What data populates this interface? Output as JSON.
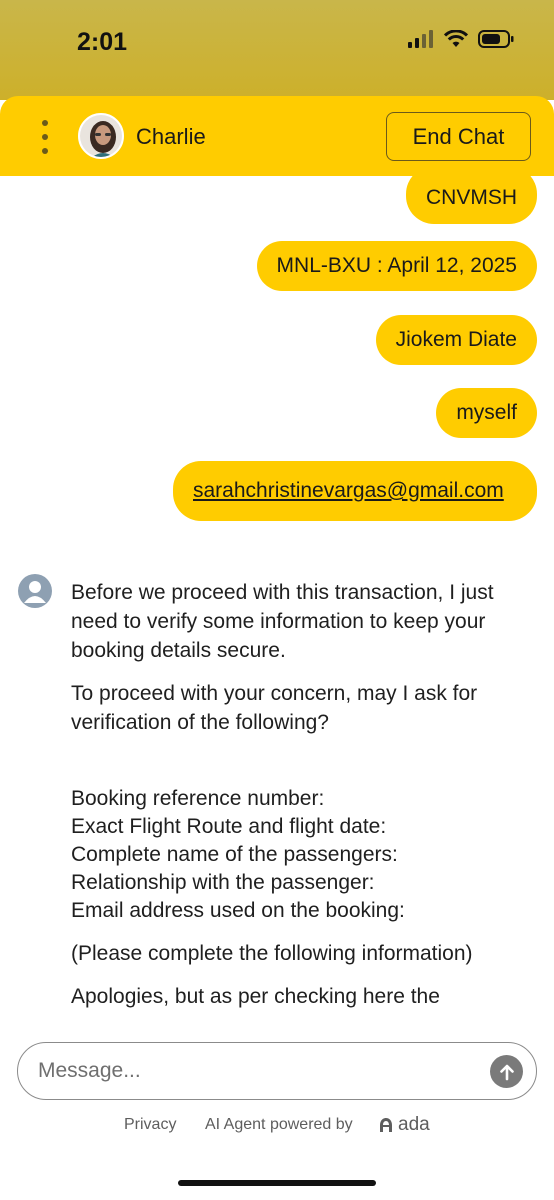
{
  "status": {
    "time": "2:01"
  },
  "header": {
    "agent_name": "Charlie",
    "end_chat_label": "End Chat"
  },
  "messages": {
    "user": [
      "CNVMSH",
      "MNL-BXU : April 12, 2025",
      "Jiokem Diate",
      "myself",
      "sarahchristinevargas@gmail.com"
    ],
    "bot": {
      "p1": "Before we proceed with this transaction, I just need to verify some information to keep your booking details secure.",
      "p2": "To proceed with your concern, may I ask for verification of the following?",
      "list": [
        "Booking reference number:",
        "Exact Flight Route and flight date:",
        "Complete name of the passengers:",
        "Relationship with the passenger:",
        "Email address used on the booking:"
      ],
      "p3": "(Please complete the following information)",
      "p4": "Apologies, but as per checking here the"
    }
  },
  "composer": {
    "placeholder": "Message..."
  },
  "footer": {
    "privacy": "Privacy",
    "powered_by": "AI Agent powered by",
    "brand": "ada"
  },
  "colors": {
    "accent": "#ffcc00",
    "status_bar": "#c9b64a"
  }
}
